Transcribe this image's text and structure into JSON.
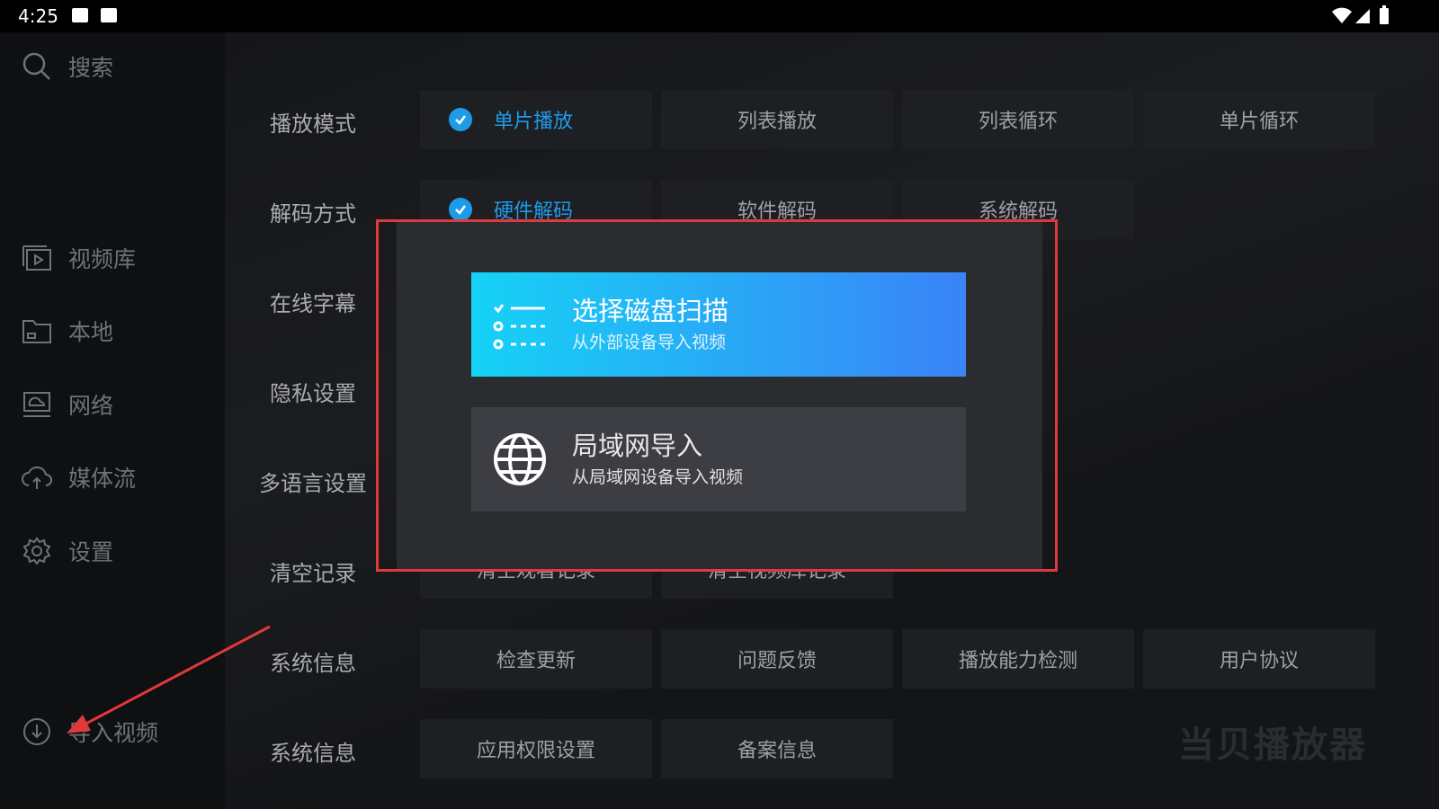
{
  "status_bar": {
    "time": "4:25"
  },
  "sidebar": {
    "search_label": "搜索",
    "items": [
      {
        "label": "视频库",
        "icon": "video-library-icon"
      },
      {
        "label": "本地",
        "icon": "folder-icon"
      },
      {
        "label": "网络",
        "icon": "network-icon"
      },
      {
        "label": "媒体流",
        "icon": "cloud-icon"
      },
      {
        "label": "设置",
        "icon": "gear-icon"
      }
    ],
    "import_label": "导入视频"
  },
  "settings": {
    "rows": [
      {
        "label": "播放模式",
        "options": [
          "单片播放",
          "列表播放",
          "列表循环",
          "单片循环"
        ],
        "selected": 0
      },
      {
        "label": "解码方式",
        "options": [
          "硬件解码",
          "软件解码",
          "系统解码"
        ],
        "selected": 0
      },
      {
        "label": "在线字幕"
      },
      {
        "label": "隐私设置"
      },
      {
        "label": "多语言设置"
      },
      {
        "label": "清空记录",
        "options": [
          "清空观看记录",
          "清空视频库记录"
        ]
      },
      {
        "label": "系统信息",
        "options": [
          "检查更新",
          "问题反馈",
          "播放能力检测",
          "用户协议"
        ]
      },
      {
        "label": "系统信息",
        "options": [
          "应用权限设置",
          "备案信息"
        ]
      }
    ]
  },
  "watermark": "当贝播放器",
  "dialog": {
    "primary": {
      "title": "选择磁盘扫描",
      "subtitle": "从外部设备导入视频",
      "icon": "checklist-icon"
    },
    "secondary": {
      "title": "局域网导入",
      "subtitle": "从局域网设备导入视频",
      "icon": "globe-icon"
    }
  },
  "colors": {
    "accent": "#1e9be8",
    "highlight": "#e0393b",
    "gradient_start": "#16d2f6",
    "gradient_end": "#3a83f7"
  }
}
